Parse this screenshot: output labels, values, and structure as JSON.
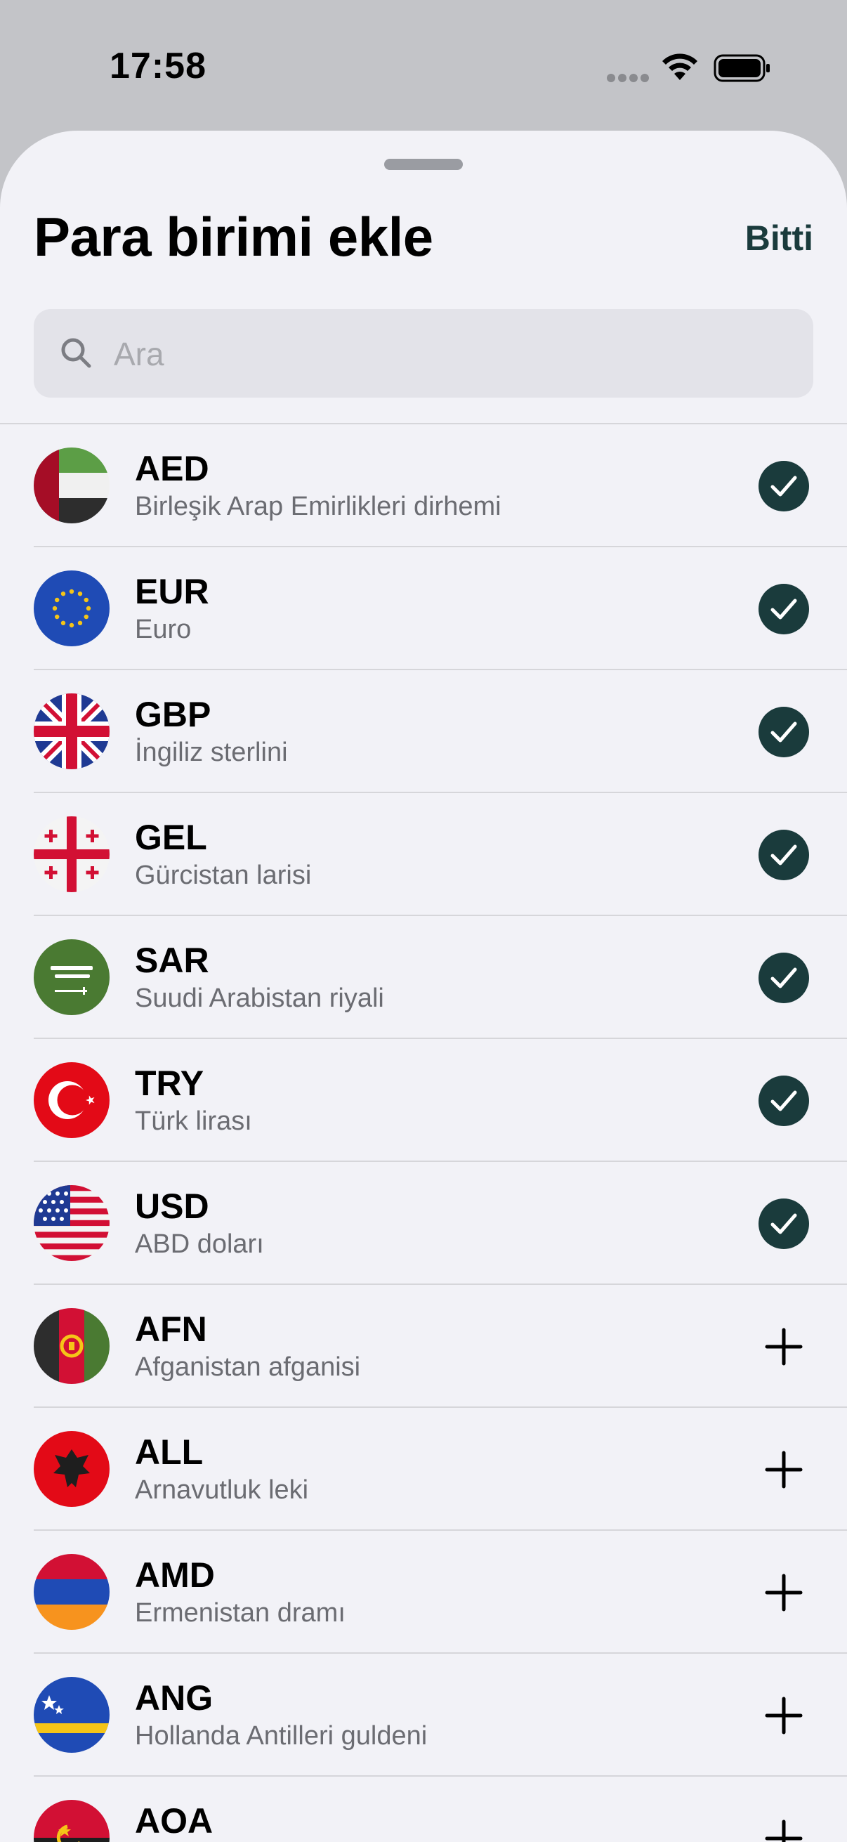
{
  "status_bar": {
    "time": "17:58",
    "signal_icon": "signal-dots-icon",
    "wifi_icon": "wifi-icon",
    "battery_icon": "battery-icon"
  },
  "sheet": {
    "title": "Para birimi ekle",
    "done_label": "Bitti",
    "search": {
      "placeholder": "Ara",
      "value": "",
      "icon": "search-icon"
    }
  },
  "colors": {
    "accent": "#1a3b3c",
    "sheet_bg": "#f2f2f7",
    "separator": "#d6d6da"
  },
  "currencies": [
    {
      "code": "AED",
      "name": "Birleşik Arap Emirlikleri dirhemi",
      "selected": true,
      "flag": "uae-flag-icon"
    },
    {
      "code": "EUR",
      "name": "Euro",
      "selected": true,
      "flag": "eu-flag-icon"
    },
    {
      "code": "GBP",
      "name": "İngiliz sterlini",
      "selected": true,
      "flag": "uk-flag-icon"
    },
    {
      "code": "GEL",
      "name": "Gürcistan larisi",
      "selected": true,
      "flag": "georgia-flag-icon"
    },
    {
      "code": "SAR",
      "name": "Suudi Arabistan riyali",
      "selected": true,
      "flag": "saudi-flag-icon"
    },
    {
      "code": "TRY",
      "name": "Türk lirası",
      "selected": true,
      "flag": "turkey-flag-icon"
    },
    {
      "code": "USD",
      "name": "ABD doları",
      "selected": true,
      "flag": "usa-flag-icon"
    },
    {
      "code": "AFN",
      "name": "Afganistan afganisi",
      "selected": false,
      "flag": "afghanistan-flag-icon"
    },
    {
      "code": "ALL",
      "name": "Arnavutluk leki",
      "selected": false,
      "flag": "albania-flag-icon"
    },
    {
      "code": "AMD",
      "name": "Ermenistan dramı",
      "selected": false,
      "flag": "armenia-flag-icon"
    },
    {
      "code": "ANG",
      "name": "Hollanda Antilleri guldeni",
      "selected": false,
      "flag": "curacao-flag-icon"
    },
    {
      "code": "AOA",
      "name": "",
      "selected": false,
      "flag": "angola-flag-icon"
    }
  ]
}
